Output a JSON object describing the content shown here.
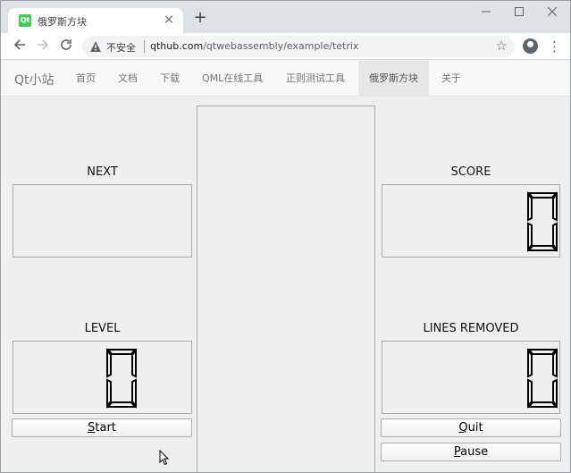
{
  "browser": {
    "tab_title": "俄罗斯方块",
    "tab_favicon_text": "Qt",
    "new_tab_glyph": "+",
    "insecure_label": "不安全",
    "url_host": "qthub.com",
    "url_path": "/qtwebassembly/example/tetrix"
  },
  "site": {
    "brand": "Qt小站",
    "nav": [
      {
        "label": "首页"
      },
      {
        "label": "文档"
      },
      {
        "label": "下载"
      },
      {
        "label": "QML在线工具"
      },
      {
        "label": "正则测试工具"
      },
      {
        "label": "俄罗斯方块",
        "active": true
      },
      {
        "label": "关于"
      }
    ]
  },
  "game": {
    "next_label": "NEXT",
    "score_label": "SCORE",
    "level_label": "LEVEL",
    "lines_label": "LINES REMOVED",
    "score": "0",
    "level": "0",
    "lines": "0",
    "start_button": {
      "mnemonic": "S",
      "rest": "tart"
    },
    "quit_button": {
      "mnemonic": "Q",
      "rest": "uit"
    },
    "pause_button": {
      "mnemonic": "P",
      "rest": "ause"
    }
  },
  "colors": {
    "accent_favicon": "#41cd52",
    "lcd_digit": "#000000"
  }
}
